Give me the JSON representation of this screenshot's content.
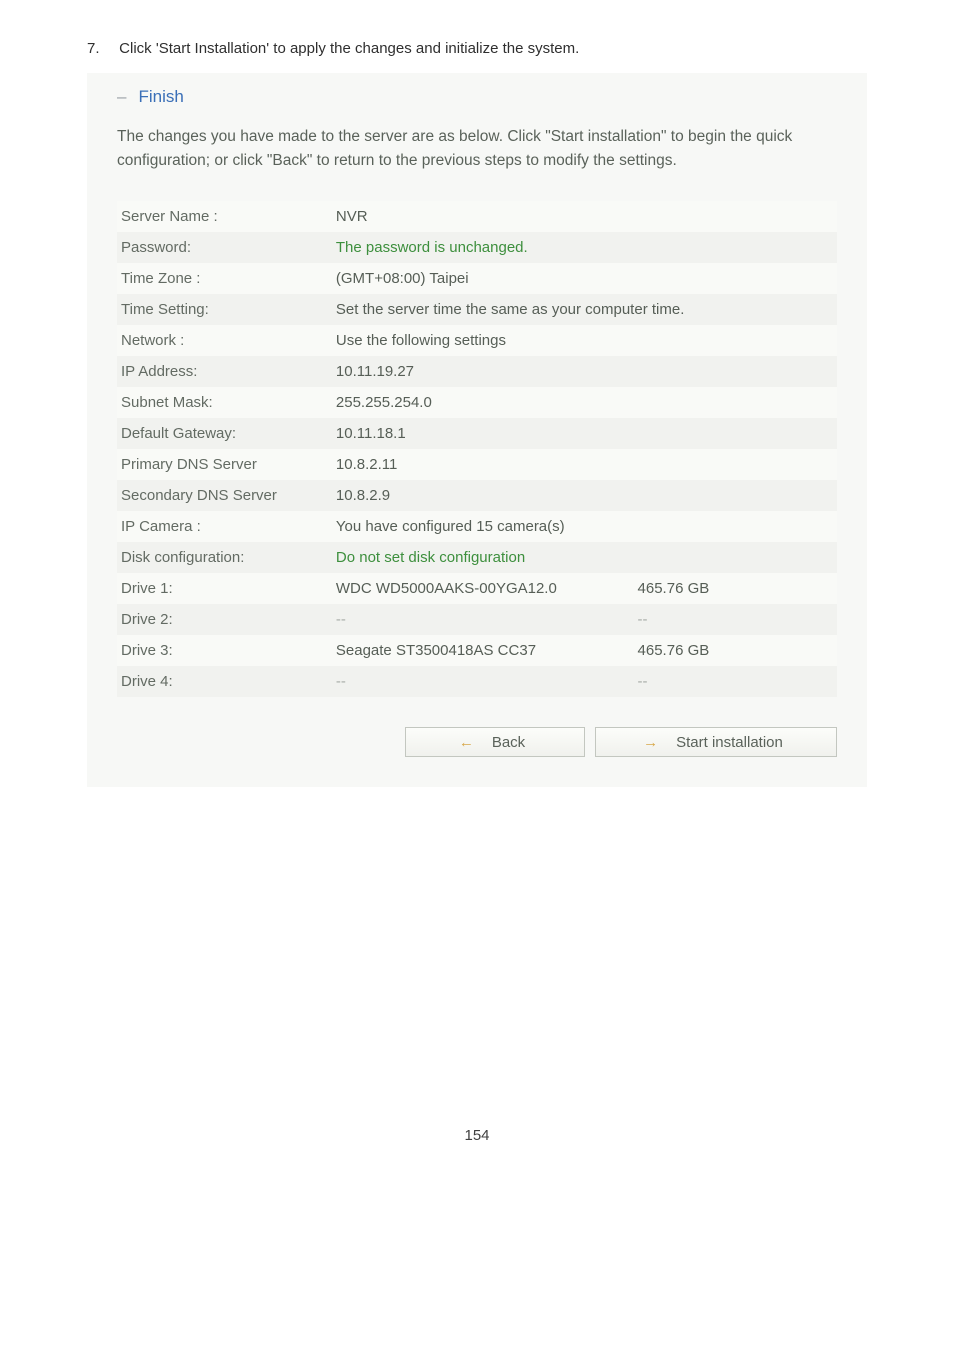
{
  "instruction": {
    "number": "7.",
    "text": "Click 'Start Installation' to apply the changes and initialize the system."
  },
  "panel": {
    "header_dash": "–",
    "header_label": "Finish",
    "intro": "The changes you have made to the server are as below. Click \"Start installation\" to begin the quick configuration; or click \"Back\" to return to the previous steps to modify the settings."
  },
  "rows": {
    "server_name_label": "Server Name :",
    "server_name_value": "NVR",
    "password_label": "Password:",
    "password_value": "The password is unchanged.",
    "timezone_label": "Time Zone :",
    "timezone_value": "(GMT+08:00) Taipei",
    "timesetting_label": "Time Setting:",
    "timesetting_value": "Set the server time the same as your computer time.",
    "network_label": "Network :",
    "network_value": "Use the following settings",
    "ip_label": "IP Address:",
    "ip_value": "10.11.19.27",
    "subnet_label": "Subnet Mask:",
    "subnet_value": "255.255.254.0",
    "gateway_label": "Default Gateway:",
    "gateway_value": "10.11.18.1",
    "dns1_label": "Primary DNS Server",
    "dns1_value": "10.8.2.11",
    "dns2_label": "Secondary DNS Server",
    "dns2_value": "10.8.2.9",
    "ipcam_label": "IP Camera :",
    "ipcam_value": "You have configured 15 camera(s)",
    "disk_label": "Disk configuration:",
    "disk_value": "Do not set disk configuration",
    "drive1_label": "Drive 1:",
    "drive1_model": "WDC WD5000AAKS-00YGA12.0",
    "drive1_size": "465.76 GB",
    "drive2_label": "Drive 2:",
    "drive2_model": "--",
    "drive2_size": "--",
    "drive3_label": "Drive 3:",
    "drive3_model": "Seagate ST3500418AS CC37",
    "drive3_size": "465.76 GB",
    "drive4_label": "Drive 4:",
    "drive4_model": "--",
    "drive4_size": "--"
  },
  "buttons": {
    "back": "Back",
    "start": "Start installation"
  },
  "page_number": "154"
}
